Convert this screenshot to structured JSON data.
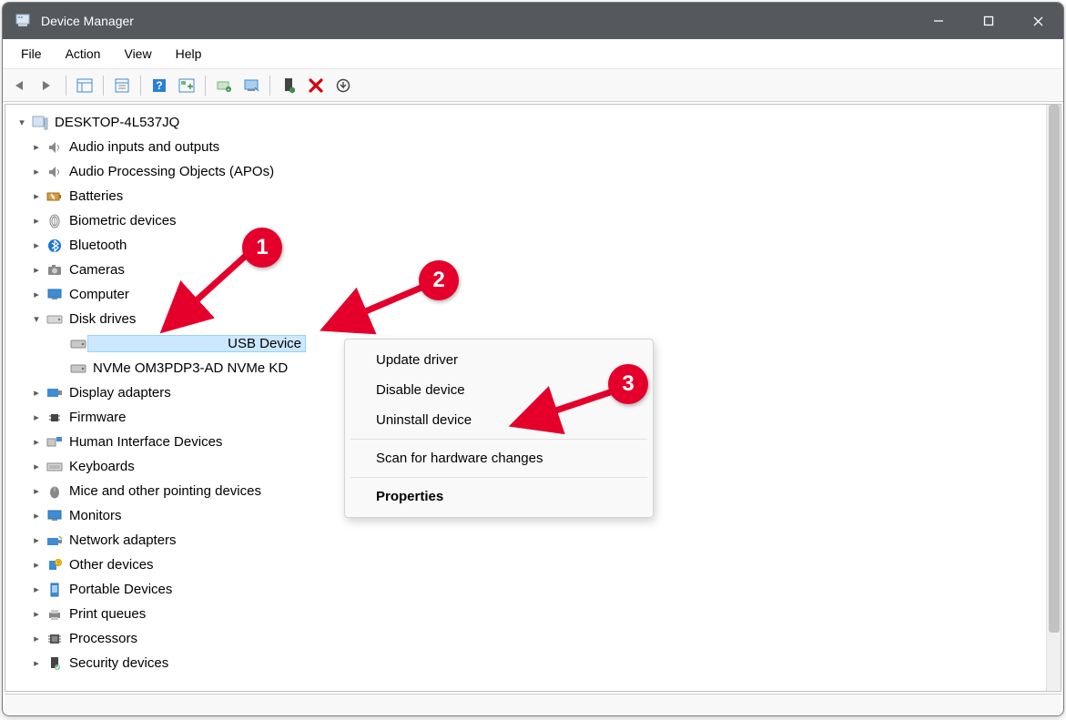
{
  "window": {
    "title": "Device Manager"
  },
  "menus": {
    "file": "File",
    "action": "Action",
    "view": "View",
    "help": "Help"
  },
  "tree": {
    "root": "DESKTOP-4L537JQ",
    "items": [
      {
        "label": "Audio inputs and outputs"
      },
      {
        "label": "Audio Processing Objects (APOs)"
      },
      {
        "label": "Batteries"
      },
      {
        "label": "Biometric devices"
      },
      {
        "label": "Bluetooth"
      },
      {
        "label": "Cameras"
      },
      {
        "label": "Computer"
      },
      {
        "label": "Disk drives",
        "expanded": true,
        "children": [
          {
            "label": "USB Device",
            "selected": true
          },
          {
            "label": "NVMe OM3PDP3-AD NVMe KD"
          }
        ]
      },
      {
        "label": "Display adapters"
      },
      {
        "label": "Firmware"
      },
      {
        "label": "Human Interface Devices"
      },
      {
        "label": "Keyboards"
      },
      {
        "label": "Mice and other pointing devices"
      },
      {
        "label": "Monitors"
      },
      {
        "label": "Network adapters"
      },
      {
        "label": "Other devices"
      },
      {
        "label": "Portable Devices"
      },
      {
        "label": "Print queues"
      },
      {
        "label": "Processors"
      },
      {
        "label": "Security devices"
      }
    ]
  },
  "context_menu": {
    "update": "Update driver",
    "disable": "Disable device",
    "uninstall": "Uninstall device",
    "scan": "Scan for hardware changes",
    "properties": "Properties"
  },
  "badges": {
    "b1": "1",
    "b2": "2",
    "b3": "3"
  }
}
